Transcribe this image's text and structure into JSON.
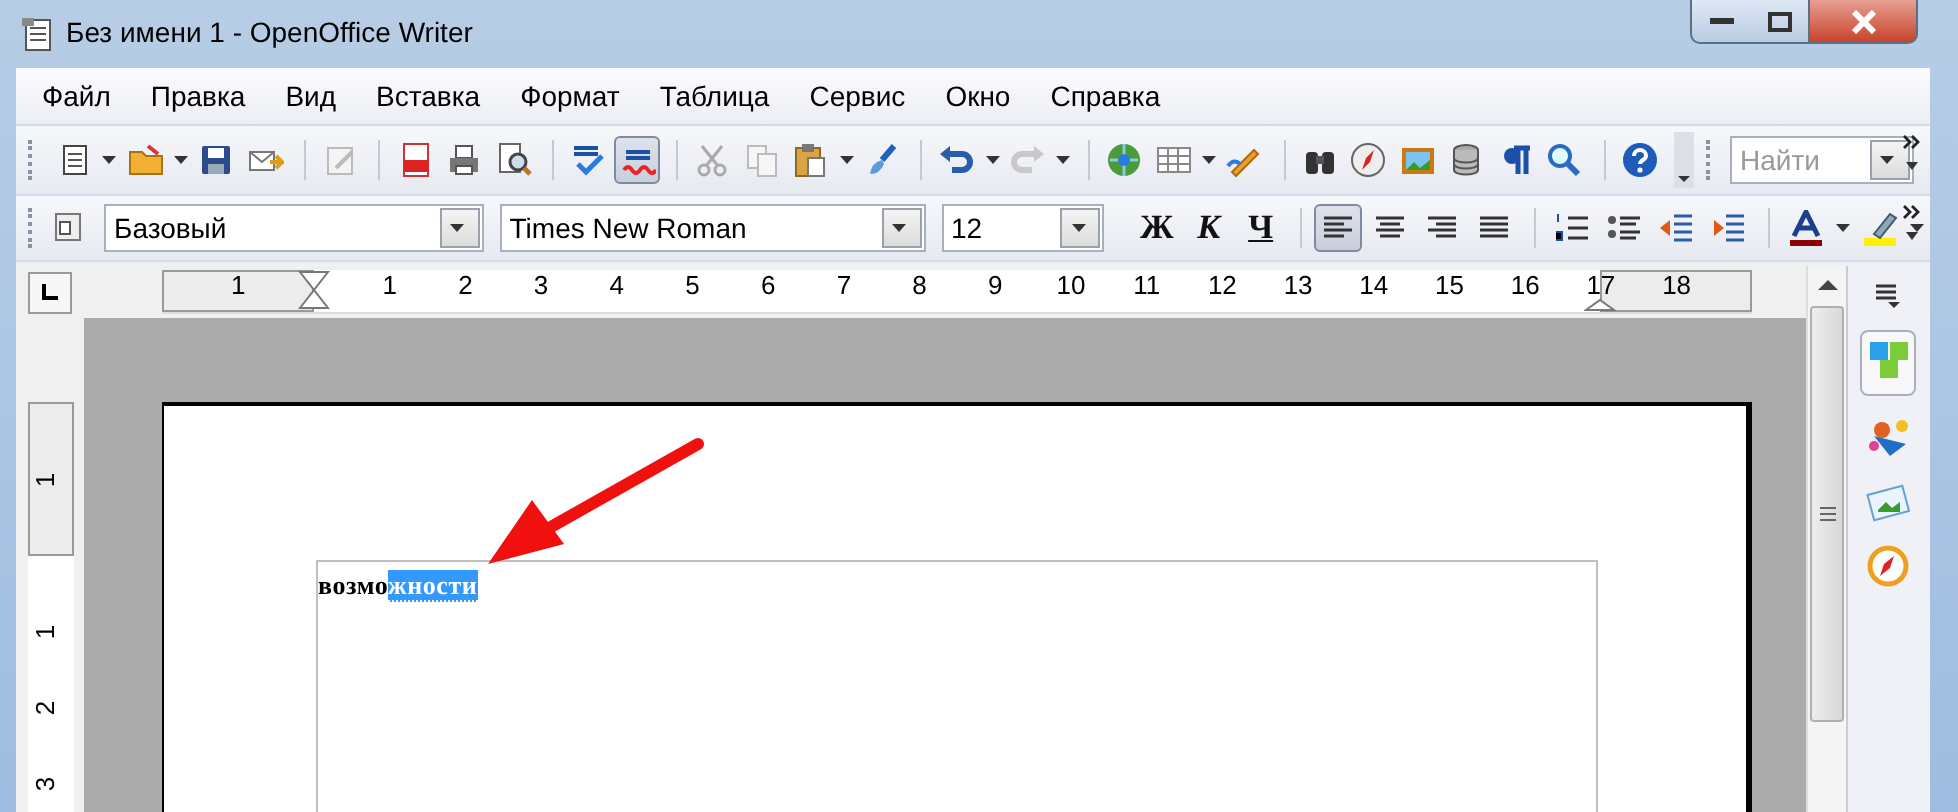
{
  "window": {
    "title": "Без имени 1 - OpenOffice Writer"
  },
  "menu": [
    {
      "label": "Файл"
    },
    {
      "label": "Правка"
    },
    {
      "label": "Вид"
    },
    {
      "label": "Вставка"
    },
    {
      "label": "Формат"
    },
    {
      "label": "Таблица"
    },
    {
      "label": "Сервис"
    },
    {
      "label": "Окно"
    },
    {
      "label": "Справка"
    }
  ],
  "standard_toolbar": {
    "autospellcheck_on": true,
    "search": {
      "placeholder": "Найти"
    }
  },
  "formatting_toolbar": {
    "paragraph_style": "Базовый",
    "font_name": "Times New Roman",
    "font_size": "12",
    "text_buttons": [
      {
        "label": "Ж",
        "kind": "bold"
      },
      {
        "label": "К",
        "kind": "italic"
      },
      {
        "label": "Ч",
        "kind": "underline"
      }
    ],
    "alignment": [
      {
        "kind": "left",
        "selected": true
      },
      {
        "kind": "center",
        "selected": false
      },
      {
        "kind": "right",
        "selected": false
      },
      {
        "kind": "justify",
        "selected": false
      }
    ]
  },
  "horizontal_ruler": {
    "labels": [
      "1",
      "1",
      "2",
      "3",
      "4",
      "5",
      "6",
      "7",
      "8",
      "9",
      "10",
      "11",
      "12",
      "13",
      "14",
      "15",
      "16",
      "17",
      "18"
    ]
  },
  "vertical_ruler": {
    "labels": [
      "1",
      "1",
      "2",
      "3"
    ]
  },
  "document": {
    "text": [
      {
        "text": "возмо",
        "selected": false
      },
      {
        "text": "жности",
        "selected": true
      }
    ]
  }
}
